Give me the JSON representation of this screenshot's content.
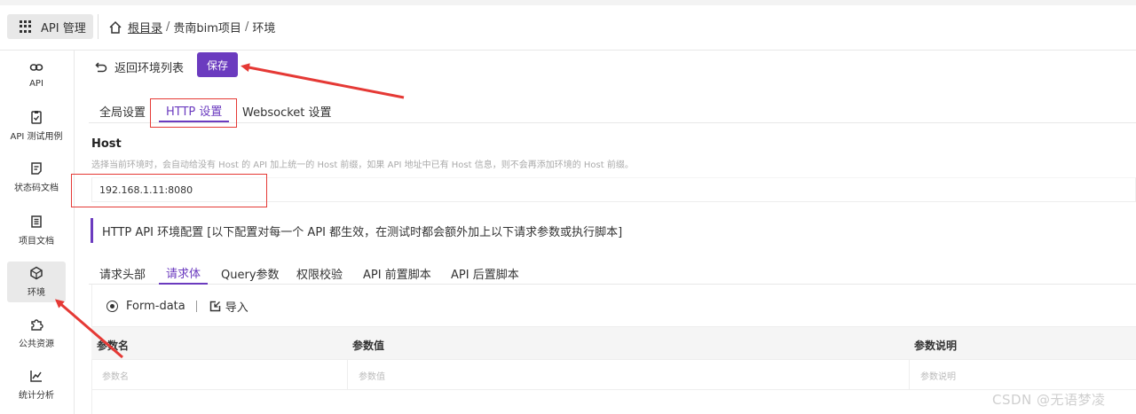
{
  "topbar": {
    "app_label": "API 管理",
    "breadcrumb": {
      "root": "根目录",
      "project": "贵南bim项目",
      "current": "环境",
      "sep": "/"
    }
  },
  "sidebar": {
    "items": [
      {
        "label": "API",
        "icon": "link-icon"
      },
      {
        "label": "API 测试用例",
        "icon": "clipboard-icon"
      },
      {
        "label": "状态码文档",
        "icon": "doc-icon"
      },
      {
        "label": "项目文档",
        "icon": "list-doc-icon"
      },
      {
        "label": "环境",
        "icon": "cube-icon",
        "active": true
      },
      {
        "label": "公共资源",
        "icon": "puzzle-icon"
      },
      {
        "label": "统计分析",
        "icon": "chart-icon"
      }
    ]
  },
  "toolbar": {
    "back_label": "返回环境列表",
    "save_label": "保存"
  },
  "tabs": {
    "global": "全局设置",
    "http": "HTTP 设置",
    "websocket": "Websocket 设置"
  },
  "host": {
    "title": "Host",
    "description": "选择当前环境时，会自动给没有 Host 的 API 加上统一的 Host 前缀，如果 API 地址中已有 Host 信息，则不会再添加环境的 Host 前缀。",
    "value": "192.168.1.11:8080"
  },
  "section": {
    "title": "HTTP API 环境配置 [以下配置对每一个 API 都生效，在测试时都会额外加上以下请求参数或执行脚本]"
  },
  "subtabs": {
    "headers": "请求头部",
    "body": "请求体",
    "query": "Query参数",
    "auth": "权限校验",
    "pre_script": "API 前置脚本",
    "post_script": "API 后置脚本"
  },
  "body_options": {
    "form_data": "Form-data",
    "import": "导入"
  },
  "table": {
    "columns": {
      "name": "参数名",
      "value": "参数值",
      "desc": "参数说明"
    },
    "placeholders": {
      "name": "参数名",
      "value": "参数值",
      "desc": "参数说明"
    }
  },
  "watermark": "CSDN @无语梦凌",
  "colors": {
    "accent": "#6b3bbf",
    "annotation": "#e53935"
  }
}
